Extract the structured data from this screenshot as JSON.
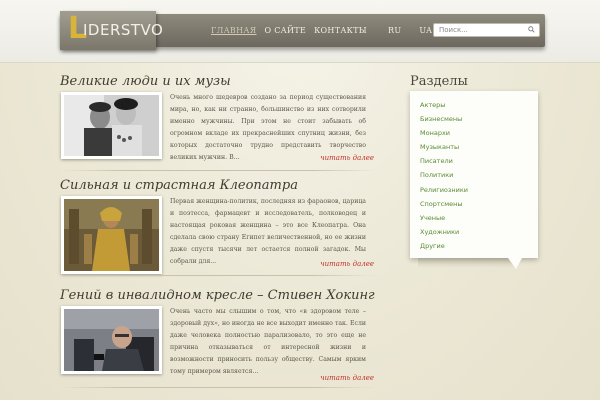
{
  "header": {
    "logo_initial": "L",
    "logo_rest": "IDERSTVO",
    "nav": [
      "ГЛАВНАЯ",
      "О САЙТЕ",
      "КОНТАКТЫ"
    ],
    "languages": [
      "RU",
      "UA"
    ],
    "search_placeholder": "Поиск..."
  },
  "articles": [
    {
      "title": "Великие люди и их музы",
      "excerpt": "Очень много шедевров создано за период существования мира, но, как ни странно, большинство из них сотворили именно мужчины. При этом не стоит забывать об огромном вкладе их прекраснейших спутниц жизни, без которых достаточно трудно представить творчество великих мужчин. В...",
      "more": "читать далее"
    },
    {
      "title": "Сильная и страстная Клеопатра",
      "excerpt": "Первая женщина-политик, последняя из фараонов, царица и поэтесса, фармацевт и исследователь, полководец и настоящая роковая женщина – это все Клеопатра. Она сделала свою страну Египет величественной, но ее жизни даже спустя тысячи лет остается полной загадок. Мы собрали для...",
      "more": "читать далее"
    },
    {
      "title": "Гений в инвалидном кресле – Стивен Хокинг",
      "excerpt": "Очень часто мы слышим о том, что «в здоровом теле – здоровый дух», но иногда не все выходит именно так. Если даже человека полностью парализовало, то это еще не причина отказываться от интересной жизни и возможности приносить пользу обществу. Самым ярким тому примером является...",
      "more": "читать далее"
    }
  ],
  "sidebar": {
    "title": "Разделы",
    "items": [
      "Актеры",
      "Бизнесмены",
      "Монархи",
      "Музыканты",
      "Писатели",
      "Политики",
      "Религиозники",
      "Спортсмены",
      "Ученые",
      "Художники",
      "Другие"
    ]
  },
  "colors": {
    "accent_link": "#c2322a",
    "sidebar_link": "#5a8a35",
    "header_bar": "#7d796d",
    "logo_accent": "#d8b43a"
  }
}
